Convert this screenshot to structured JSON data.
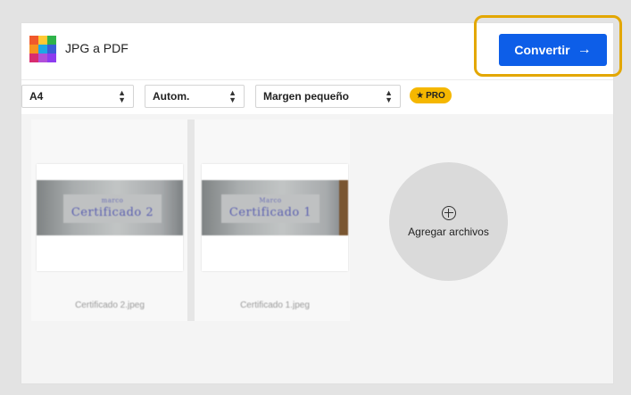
{
  "header": {
    "app_title": "JPG a PDF",
    "convert_label": "Convertir",
    "convert_arrow": "→"
  },
  "toolbar": {
    "page_size": "A4",
    "orientation": "Autom.",
    "margin": "Margen pequeño",
    "pro_badge": "PRO",
    "pro_star": "★",
    "updown": "⬆⬇"
  },
  "files": [
    {
      "note_small": "marco",
      "note_text": "Certificado 2",
      "filename": "Certificado 2.jpeg"
    },
    {
      "note_small": "Marco",
      "note_text": "Certificado 1",
      "filename": "Certificado 1.jpeg"
    }
  ],
  "add_files": {
    "label": "Agregar archivos"
  },
  "colors": {
    "accent": "#0d5ee8",
    "highlight": "#e3a700",
    "pro": "#f5b700"
  }
}
